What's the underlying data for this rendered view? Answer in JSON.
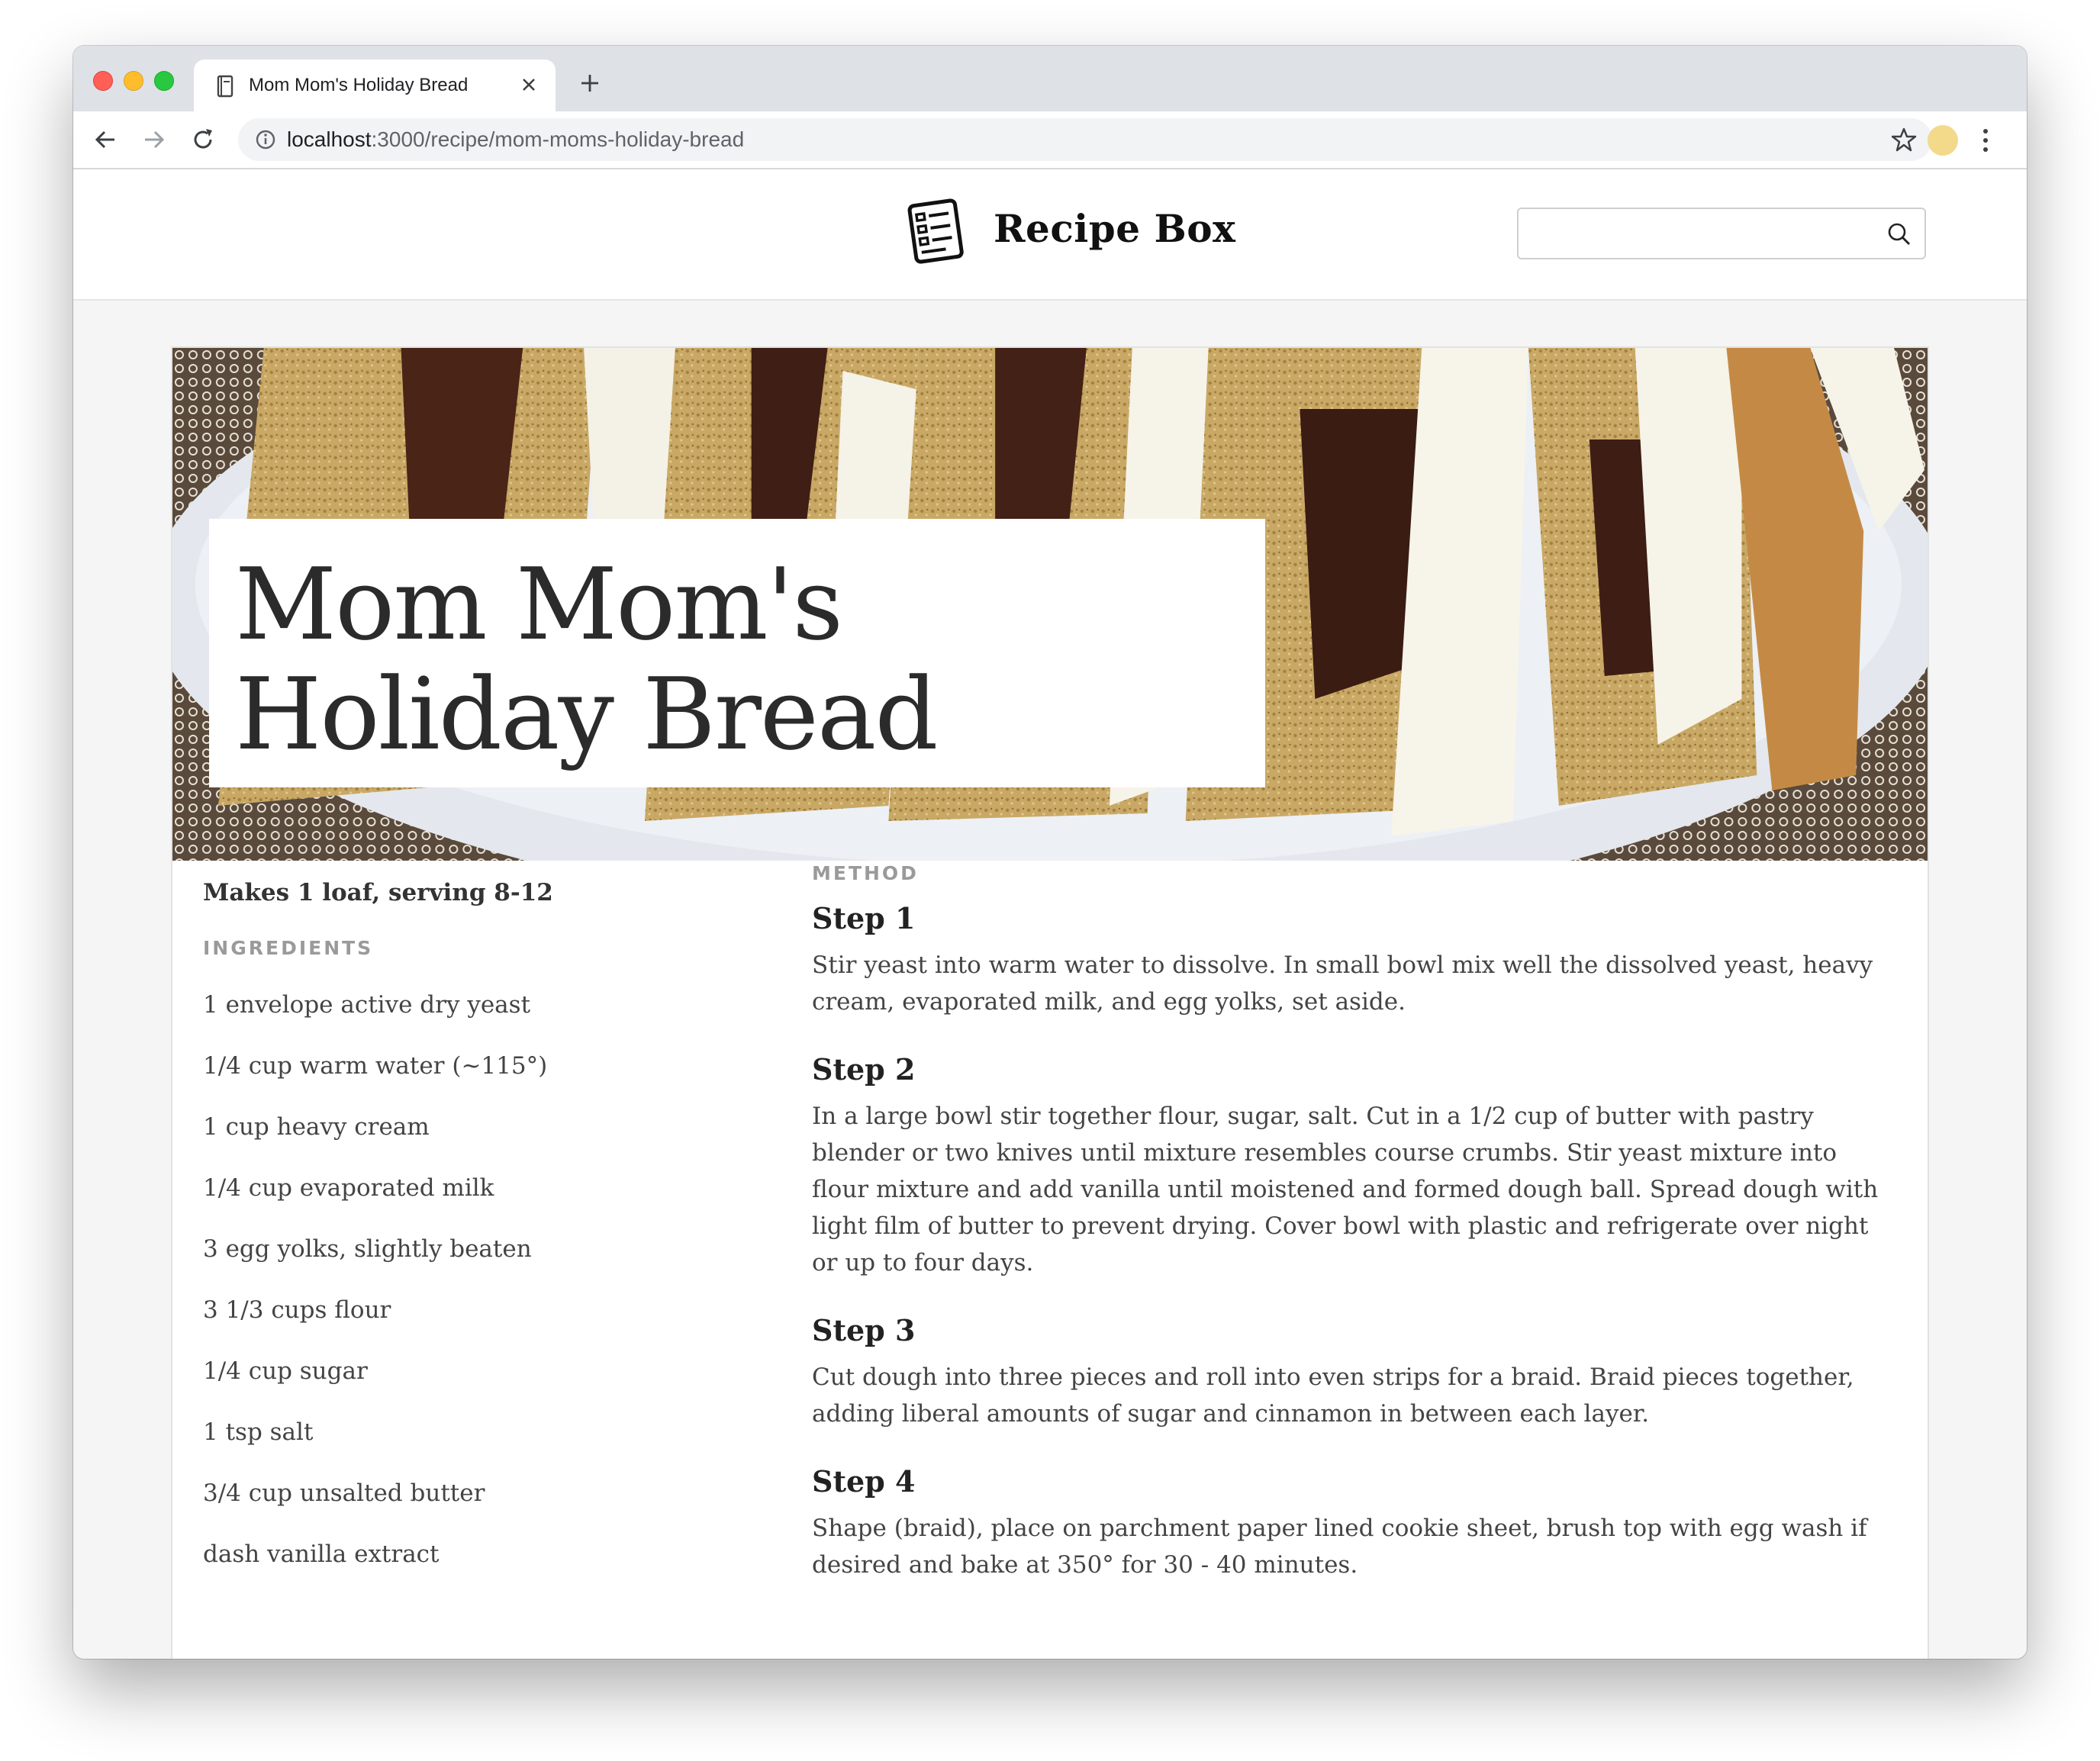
{
  "browser": {
    "tab_title": "Mom Mom's Holiday Bread",
    "url_host": "localhost",
    "url_path": ":3000/recipe/mom-moms-holiday-bread"
  },
  "site": {
    "title": "Recipe Box",
    "search_placeholder": ""
  },
  "recipe": {
    "title": "Mom Mom's Holiday Bread",
    "makes": "Makes 1 loaf, serving 8-12",
    "ingredients_label": "INGREDIENTS",
    "ingredients": [
      "1 envelope active dry yeast",
      "1/4 cup warm water (~115°)",
      "1 cup heavy cream",
      "1/4 cup evaporated milk",
      "3 egg yolks, slightly beaten",
      "3 1/3 cups flour",
      "1/4 cup sugar",
      "1 tsp salt",
      "3/4 cup unsalted butter",
      "dash vanilla extract"
    ],
    "method_label": "METHOD",
    "steps": [
      {
        "title": "Step 1",
        "text": "Stir yeast into warm water to dissolve. In small bowl mix well the dissolved yeast, heavy cream, evaporated milk, and egg yolks, set aside."
      },
      {
        "title": "Step 2",
        "text": "In a large bowl stir together flour, sugar, salt. Cut in a 1/2 cup of butter with pastry blender or two knives until mixture resembles course crumbs. Stir yeast mixture into flour mixture and add vanilla until moistened and formed dough ball. Spread dough with light film of butter to prevent drying. Cover bowl with plastic and refrigerate over night or up to four days."
      },
      {
        "title": "Step 3",
        "text": "Cut dough into three pieces and roll into even strips for a braid. Braid pieces together, adding liberal amounts of sugar and cinnamon in between each layer."
      },
      {
        "title": "Step 4",
        "text": "Shape (braid), place on parchment paper lined cookie sheet, brush top with egg wash if desired and bake at 350° for 30 - 40 minutes."
      }
    ]
  },
  "icons": {
    "tab": "notebook-icon",
    "logo": "recipe-list-icon",
    "search": "search-icon"
  }
}
